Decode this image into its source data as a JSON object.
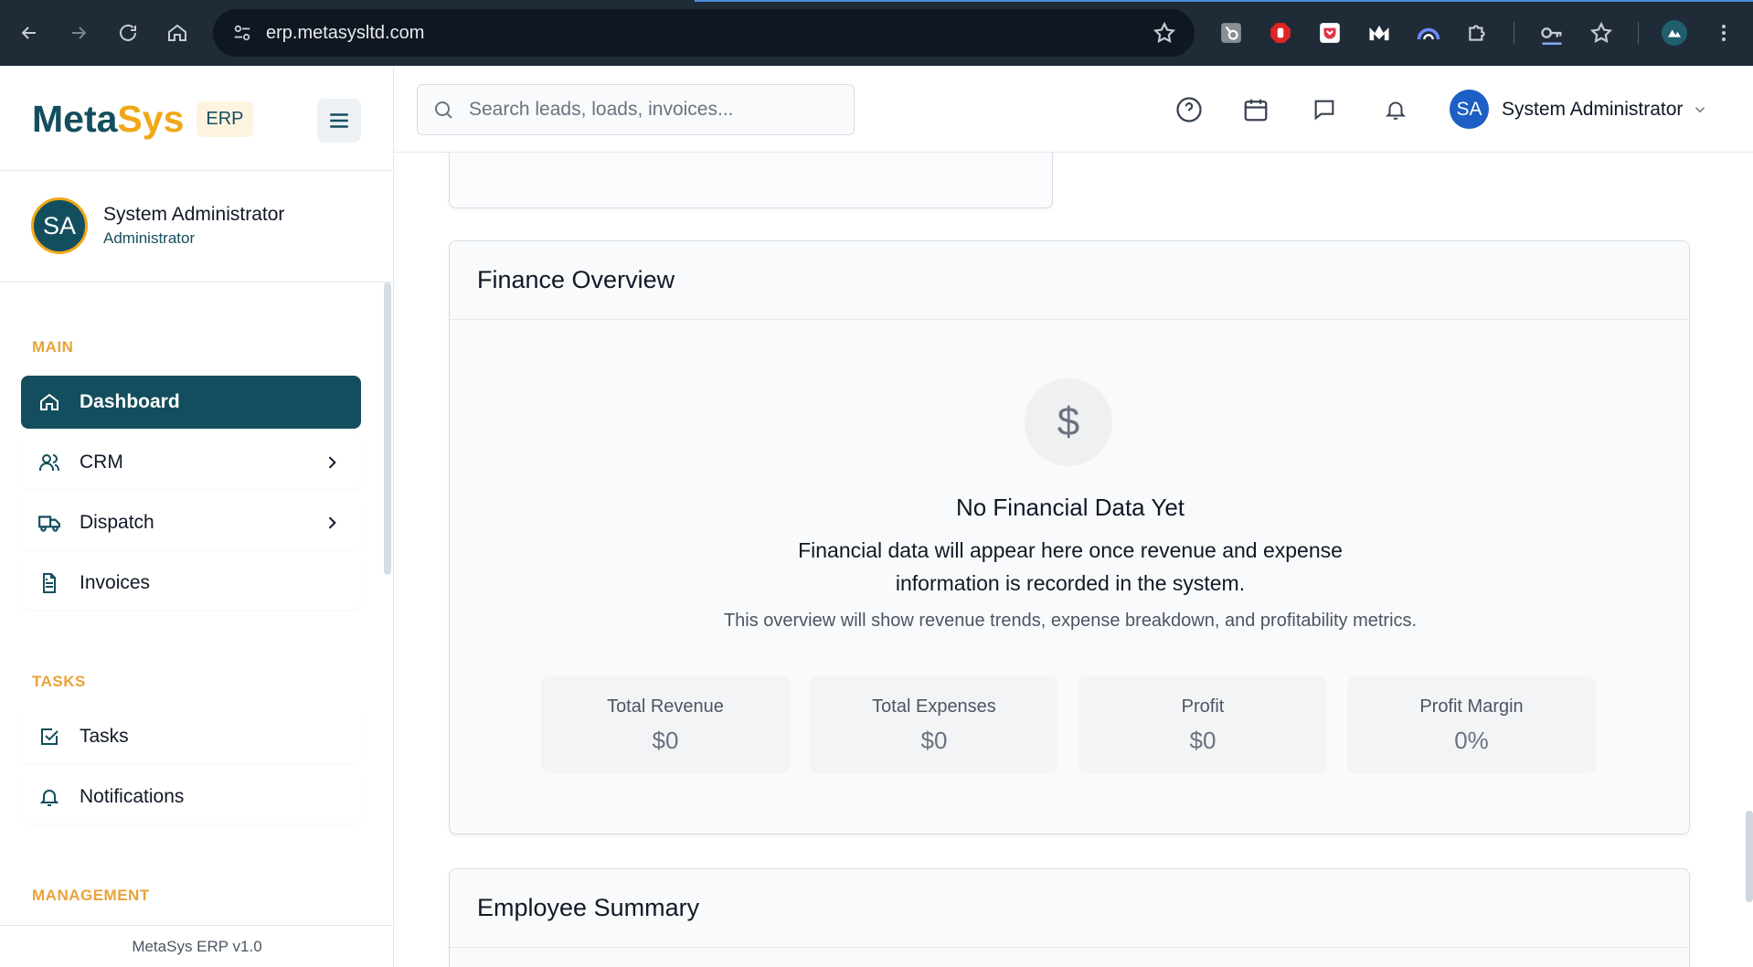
{
  "browser": {
    "url": "erp.metasysltd.com"
  },
  "sidebar": {
    "brand": {
      "part1": "Meta",
      "part2": "Sys",
      "badge": "ERP"
    },
    "user": {
      "initials": "SA",
      "name": "System Administrator",
      "role": "Administrator"
    },
    "sections": {
      "main": "MAIN",
      "tasks": "TASKS",
      "management": "MANAGEMENT"
    },
    "items": [
      {
        "label": "Dashboard",
        "icon": "home-icon",
        "active": true
      },
      {
        "label": "CRM",
        "icon": "users-icon",
        "has_children": true
      },
      {
        "label": "Dispatch",
        "icon": "truck-icon",
        "has_children": true
      },
      {
        "label": "Invoices",
        "icon": "file-text-icon"
      },
      {
        "label": "Tasks",
        "icon": "check-square-icon"
      },
      {
        "label": "Notifications",
        "icon": "bell-icon"
      }
    ],
    "footer": "MetaSys ERP v1.0"
  },
  "header": {
    "search_placeholder": "Search leads, loads, invoices...",
    "user": {
      "initials": "SA",
      "name": "System Administrator"
    }
  },
  "finance": {
    "title": "Finance Overview",
    "empty_icon": "$",
    "empty_title": "No Financial Data Yet",
    "empty_desc": "Financial data will appear here once revenue and expense information is recorded in the system.",
    "empty_note": "This overview will show revenue trends, expense breakdown, and profitability metrics.",
    "stats": [
      {
        "label": "Total Revenue",
        "value": "$0"
      },
      {
        "label": "Total Expenses",
        "value": "$0"
      },
      {
        "label": "Profit",
        "value": "$0"
      },
      {
        "label": "Profit Margin",
        "value": "0%"
      }
    ]
  },
  "employee": {
    "title": "Employee Summary"
  },
  "colors": {
    "brand_dark": "#134e5e",
    "brand_accent": "#f0a818",
    "section_label": "#e8a33a",
    "header_avatar": "#1d5fc4"
  }
}
